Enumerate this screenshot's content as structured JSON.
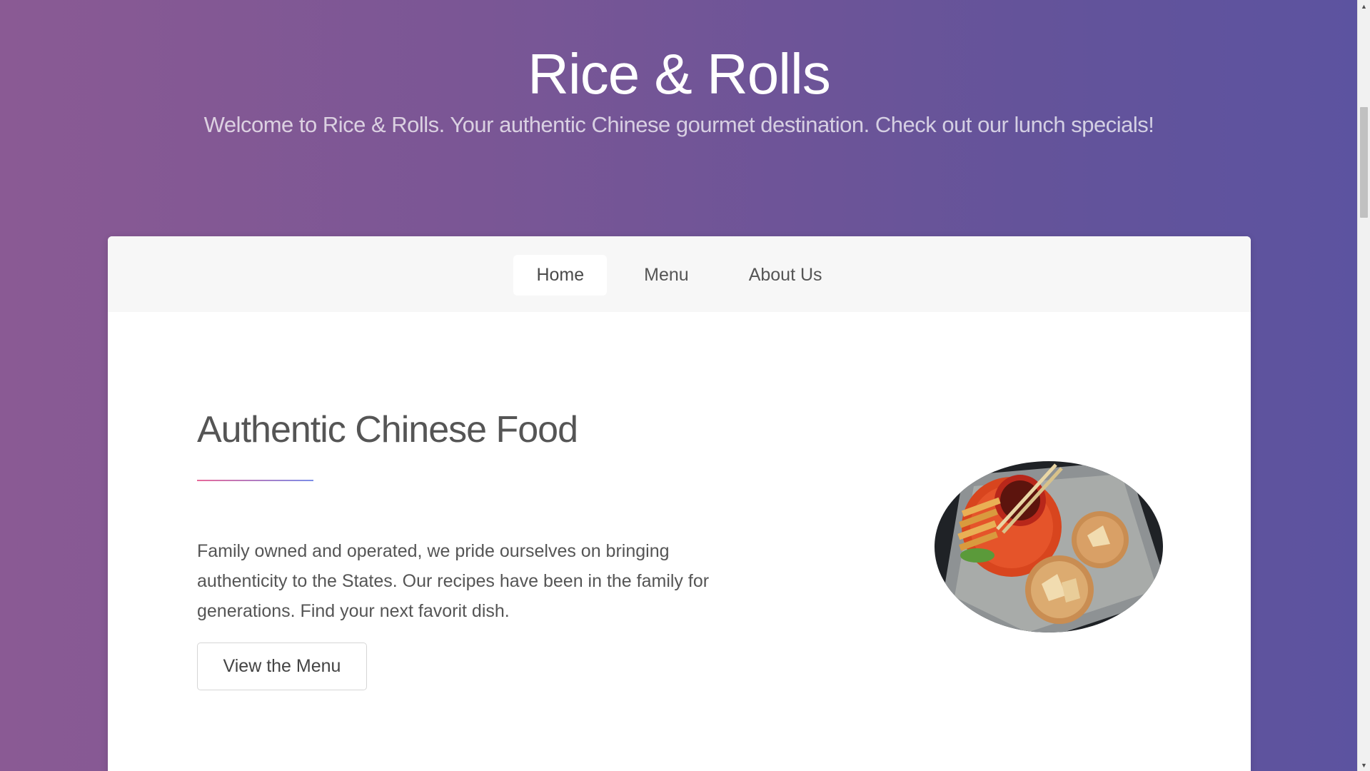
{
  "hero": {
    "title": "Rice & Rolls",
    "subtitle": "Welcome to Rice & Rolls. Your authentic Chinese gourmet destination. Check out our lunch specials!"
  },
  "nav": {
    "items": [
      {
        "label": "Home",
        "active": true
      },
      {
        "label": "Menu",
        "active": false
      },
      {
        "label": "About Us",
        "active": false
      }
    ]
  },
  "intro": {
    "title": "Authentic Chinese Food",
    "body": "Family owned and operated, we pride ourselves on bringing authenticity to the States. Our recipes have been in the family for generations. Find your next favorit dish.",
    "button_label": "View the Menu"
  },
  "colors": {
    "gradient_left": "#8a5a94",
    "gradient_right": "#5c53a0",
    "divider_start": "#e86a9a",
    "divider_end": "#7b8ee8"
  }
}
